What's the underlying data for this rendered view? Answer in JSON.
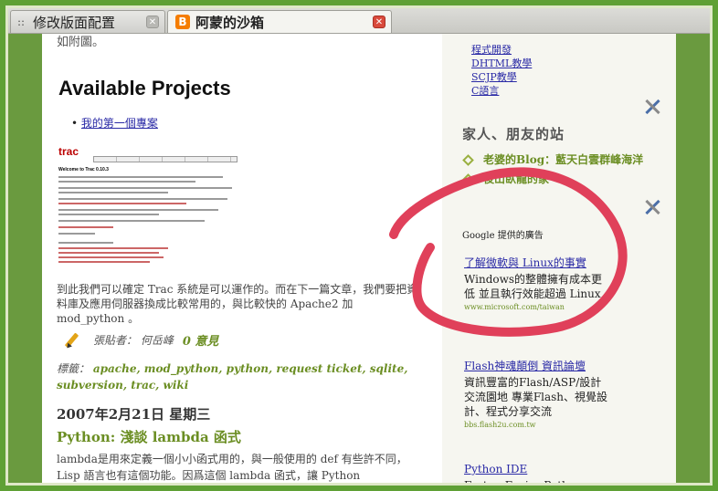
{
  "tabs": [
    {
      "label": "修改版面配置",
      "active": false
    },
    {
      "label": "阿蒙的沙箱",
      "active": true
    }
  ],
  "main": {
    "top_text": "如附圖。",
    "heading": "Available Projects",
    "project_link": "我的第一個專案",
    "screenshot": {
      "logo": "trac",
      "welcome": "Welcome to Trac 0.10.3"
    },
    "paragraph": "到此我們可以確定 Trac 系統是可以運作的。而在下一篇文章，我們要把資料庫及應用伺服器換成比較常用的，與比較快的 Apache2 加 mod_python 。",
    "posted_by": "張貼者： 何岳峰",
    "comments": "0 意見",
    "tags_label": "標籤：",
    "tags": "apache, mod_python, python, request ticket, sqlite, subversion, trac, wiki",
    "date": "2007年2月21日 星期三",
    "post_title": "Python: 淺談 lambda 函式",
    "post_body": "lambda是用來定義一個小小函式用的，與一般使用的 def 有些許不同， Lisp 語言也有這個功能。因爲這個 lambda 函式，讓 Python"
  },
  "sidebar": {
    "links": [
      "程式開發",
      "DHTML教學",
      "SCJP教學",
      "C語言"
    ],
    "friends_heading": "家人、朋友的站",
    "friends": [
      "老婆的Blog：藍天白雲群峰海洋",
      "後山臥龍的家"
    ],
    "google_label": "Google 提供的廣告",
    "ads": [
      {
        "title": "了解微軟與 Linux的事實",
        "body": "Windows的整體擁有成本更低 並且執行效能超過 Linux",
        "url": "www.microsoft.com/taiwan"
      },
      {
        "title": "Flash神魂顛倒 資訊論壇",
        "body": "資訊豐富的Flash/ASP/設計交流園地 專業Flash、視覺設計、程式分享交流",
        "url": "bbs.flash2u.com.tw"
      },
      {
        "title": "Python IDE",
        "body": "Faster, Easier Python",
        "url": ""
      }
    ]
  },
  "colors": {
    "accent": "#6b8e23",
    "link": "#2a2aa6",
    "frame": "#4d8c2a",
    "annotation": "#e0405a"
  }
}
